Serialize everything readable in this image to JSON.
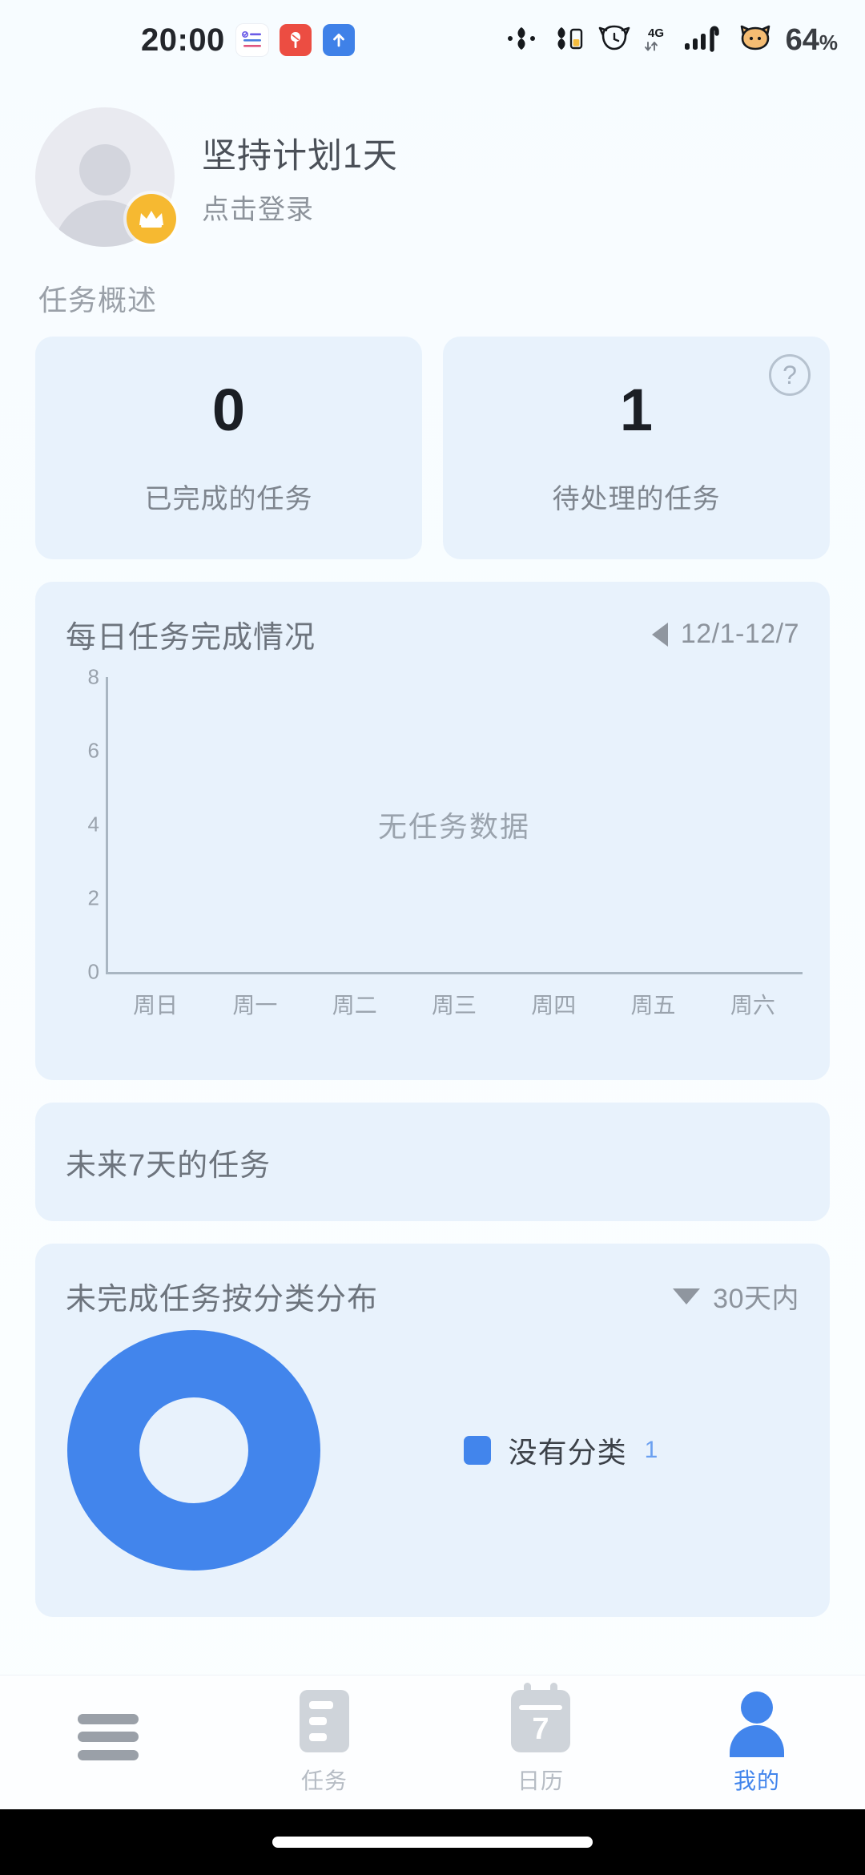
{
  "status_bar": {
    "time": "20:00",
    "notification_icons": [
      "todo-list-icon",
      "red-app-icon",
      "blue-upload-icon"
    ],
    "right_icons": [
      "bluetooth-icon",
      "bluetooth-battery-icon",
      "alarm-cat-icon",
      "network-4g-icon",
      "signal-bars-icon",
      "pet-cat-icon"
    ],
    "network_label": "4G",
    "battery_percent": "64",
    "battery_unit": "%"
  },
  "profile": {
    "name": "坚持计划1天",
    "subtitle": "点击登录",
    "badge": "crown-icon"
  },
  "overview": {
    "section_title": "任务概述",
    "cards": [
      {
        "value": "0",
        "label": "已完成的任务"
      },
      {
        "value": "1",
        "label": "待处理的任务",
        "help": "?"
      }
    ]
  },
  "daily_chart": {
    "title": "每日任务完成情况",
    "range_label": "12/1-12/7",
    "prev_icon": "triangle-left-icon",
    "empty_text": "无任务数据"
  },
  "upcoming": {
    "title": "未来7天的任务"
  },
  "category_chart": {
    "title": "未完成任务按分类分布",
    "range_label": "30天内",
    "dropdown_icon": "triangle-down-icon",
    "legend": [
      {
        "label": "没有分类",
        "value": "1",
        "color": "#4285ec"
      }
    ]
  },
  "bottom_nav": {
    "items": [
      {
        "label": "",
        "icon": "hamburger-menu-icon",
        "active": false
      },
      {
        "label": "任务",
        "icon": "document-icon",
        "active": false
      },
      {
        "label": "日历",
        "icon": "calendar-icon",
        "day": "7",
        "active": false
      },
      {
        "label": "我的",
        "icon": "person-icon",
        "active": true
      }
    ]
  },
  "colors": {
    "accent": "#4285ec",
    "card_bg": "#e8f2fc",
    "page_bg": "#f8fcff",
    "badge_gold": "#f6b931",
    "muted_text": "#9aa0a8"
  },
  "chart_data": [
    {
      "type": "bar",
      "title": "每日任务完成情况",
      "categories": [
        "周日",
        "周一",
        "周二",
        "周三",
        "周四",
        "周五",
        "周六"
      ],
      "values": [
        0,
        0,
        0,
        0,
        0,
        0,
        0
      ],
      "xlabel": "",
      "ylabel": "",
      "ylim": [
        0,
        8
      ],
      "yticks": [
        0,
        2,
        4,
        6,
        8
      ],
      "grid": false,
      "legend": "none",
      "annotation": "无任务数据",
      "range": "12/1-12/7"
    },
    {
      "type": "pie",
      "title": "未完成任务按分类分布",
      "categories": [
        "没有分类"
      ],
      "values": [
        1
      ],
      "colors": [
        "#4285ec"
      ],
      "donut": true,
      "legend": "right",
      "range": "30天内"
    }
  ]
}
